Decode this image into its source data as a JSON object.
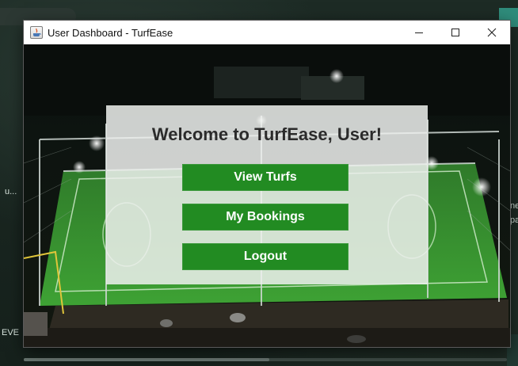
{
  "window": {
    "title": "User Dashboard - TurfEase",
    "controls": [
      "minimize-icon",
      "maximize-icon",
      "close-icon"
    ]
  },
  "panel": {
    "welcome_text": "Welcome to TurfEase, User!",
    "buttons": [
      {
        "label": "View Turfs"
      },
      {
        "label": "My Bookings"
      },
      {
        "label": "Logout"
      }
    ]
  },
  "background_edge_text": {
    "left_middle": "u...",
    "left_bottom": "EVE",
    "right_middle_1": "ne",
    "right_middle_2": "pa"
  },
  "colors": {
    "button_bg": "#228b22",
    "button_text": "#ffffff",
    "panel_bg": "#eef0ee",
    "titlebar_bg": "#ffffff"
  }
}
